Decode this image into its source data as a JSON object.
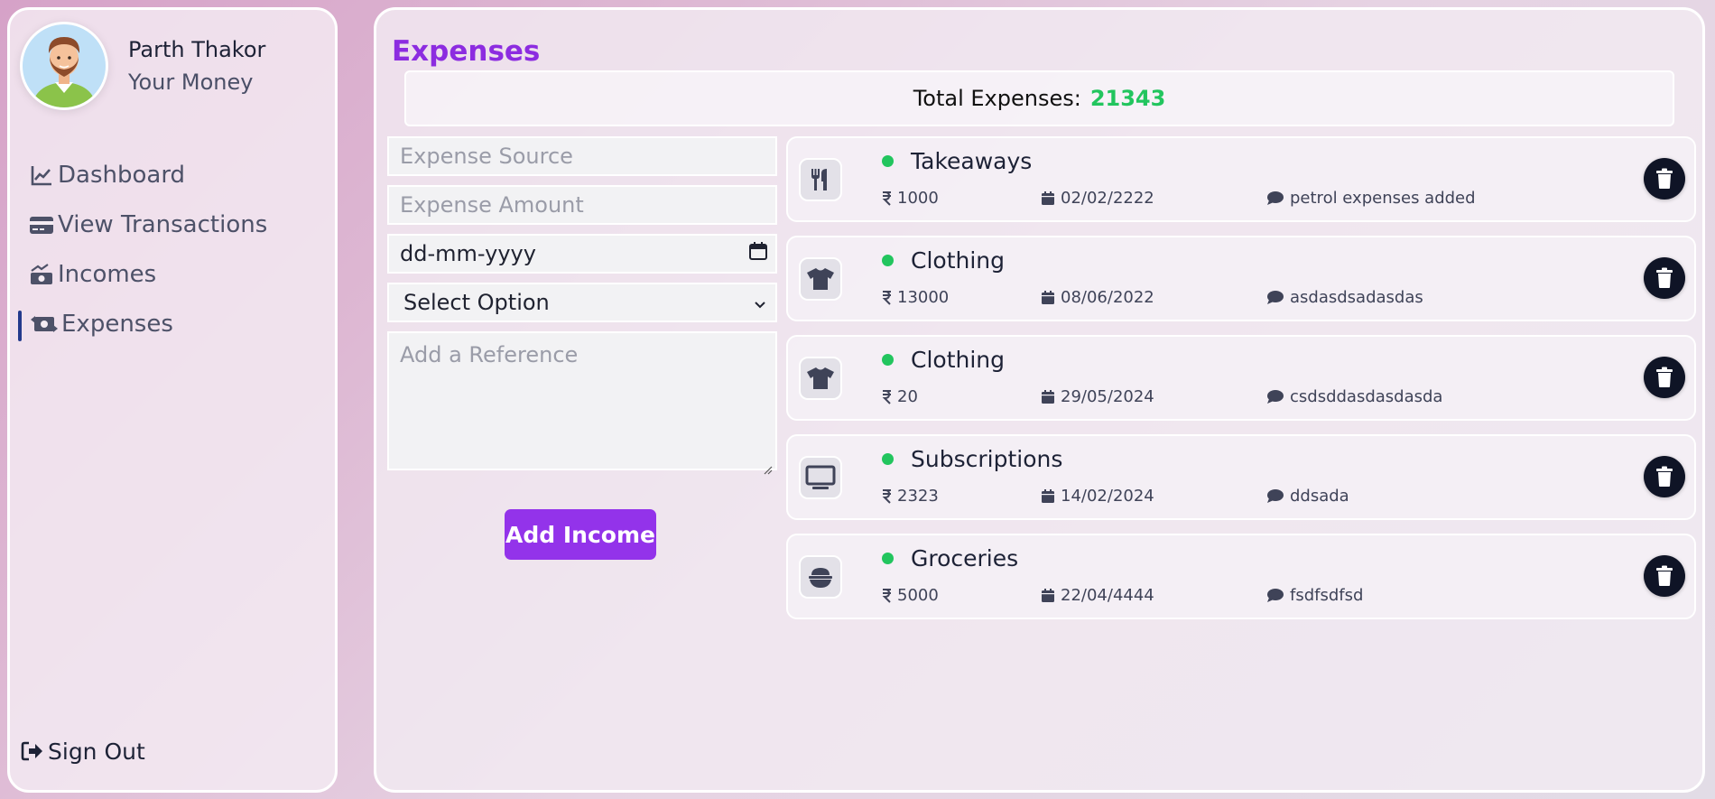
{
  "user": {
    "name": "Parth Thakor",
    "subtitle": "Your Money"
  },
  "nav": {
    "items": [
      {
        "label": "Dashboard",
        "icon": "chart-line-icon"
      },
      {
        "label": "View Transactions",
        "icon": "credit-card-icon"
      },
      {
        "label": "Incomes",
        "icon": "money-bill-trend-icon"
      },
      {
        "label": "Expenses",
        "icon": "money-bill-transfer-icon",
        "active": true
      }
    ],
    "sign_out": "Sign Out"
  },
  "page": {
    "title": "Expenses",
    "total_label": "Total Expenses:",
    "total_value": "21343"
  },
  "form": {
    "source_placeholder": "Expense Source",
    "amount_placeholder": "Expense Amount",
    "date_placeholder": "dd-mm-yyyy",
    "select_value": "Select Option",
    "reference_placeholder": "Add a Reference",
    "submit_label": "Add Income"
  },
  "expenses": [
    {
      "title": "Takeaways",
      "amount": "1000",
      "date": "02/02/2222",
      "note": "petrol expenses added",
      "icon": "utensils-icon"
    },
    {
      "title": "Clothing",
      "amount": "13000",
      "date": "08/06/2022",
      "note": "asdasdsadasdas",
      "icon": "shirt-icon"
    },
    {
      "title": "Clothing",
      "amount": "20",
      "date": "29/05/2024",
      "note": "csdsddasdasdasda",
      "icon": "shirt-icon"
    },
    {
      "title": "Subscriptions",
      "amount": "2323",
      "date": "14/02/2024",
      "note": "ddsada",
      "icon": "tv-icon"
    },
    {
      "title": "Groceries",
      "amount": "5000",
      "date": "22/04/4444",
      "note": "fsdfsdfsd",
      "icon": "bowl-food-icon"
    }
  ],
  "colors": {
    "accent": "#9333ea",
    "title": "#8c2ce0",
    "success": "#22c55e",
    "dark": "#0f1426"
  }
}
